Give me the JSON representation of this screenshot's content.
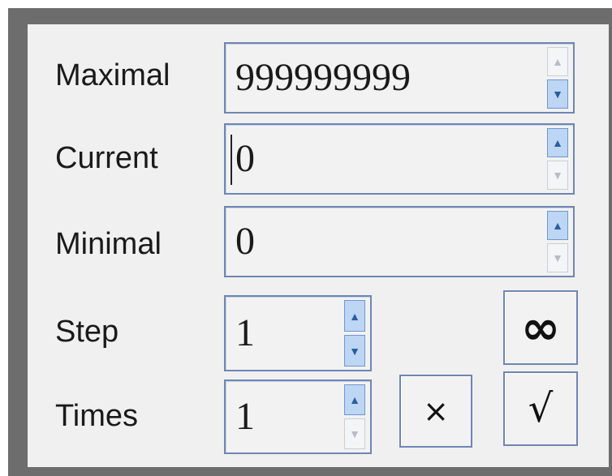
{
  "fields": [
    {
      "label": "Maximal",
      "value": "999999999"
    },
    {
      "label": "Current",
      "value": "0"
    },
    {
      "label": "Minimal",
      "value": "0"
    },
    {
      "label": "Step",
      "value": "1"
    },
    {
      "label": "Times",
      "value": "1"
    }
  ],
  "buttons": {
    "infinity": "∞",
    "cancel": "×",
    "confirm": "√"
  },
  "icons": {
    "up": "▲",
    "down": "▼"
  },
  "colors": {
    "border": "#6f86b2",
    "arrow_active": "#bcd6f4",
    "panel": "#f0f0f0",
    "frame": "#6d6d6d"
  }
}
